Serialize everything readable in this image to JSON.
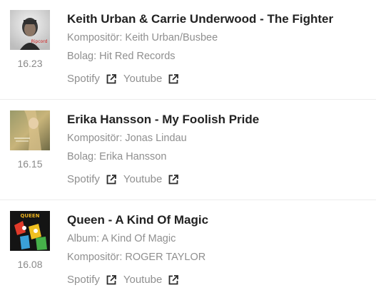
{
  "tracks": [
    {
      "time": "16.23",
      "title": "Keith Urban & Carrie Underwood - The Fighter",
      "meta_line_1": "Kompositör: Keith Urban/Busbee",
      "meta_line_2": "Bolag: Hit Red Records",
      "spotify_label": "Spotify",
      "youtube_label": "Youtube",
      "cover_text": "Ripcord"
    },
    {
      "time": "16.15",
      "title": "Erika Hansson - My Foolish Pride",
      "meta_line_1": "Kompositör: Jonas Lindau",
      "meta_line_2": "Bolag: Erika Hansson",
      "spotify_label": "Spotify",
      "youtube_label": "Youtube"
    },
    {
      "time": "16.08",
      "title": "Queen - A Kind Of Magic",
      "meta_line_1": "Album: A Kind Of Magic",
      "meta_line_2": "Kompositör: ROGER TAYLOR",
      "spotify_label": "Spotify",
      "youtube_label": "Youtube",
      "cover_text": "QUEEN"
    }
  ],
  "icons": {
    "external_link": "external-link-icon"
  },
  "colors": {
    "title": "#222222",
    "meta": "#8f8f8f",
    "link": "#8f8f8f",
    "icon": "#2b2b2b",
    "divider": "#ececec"
  }
}
